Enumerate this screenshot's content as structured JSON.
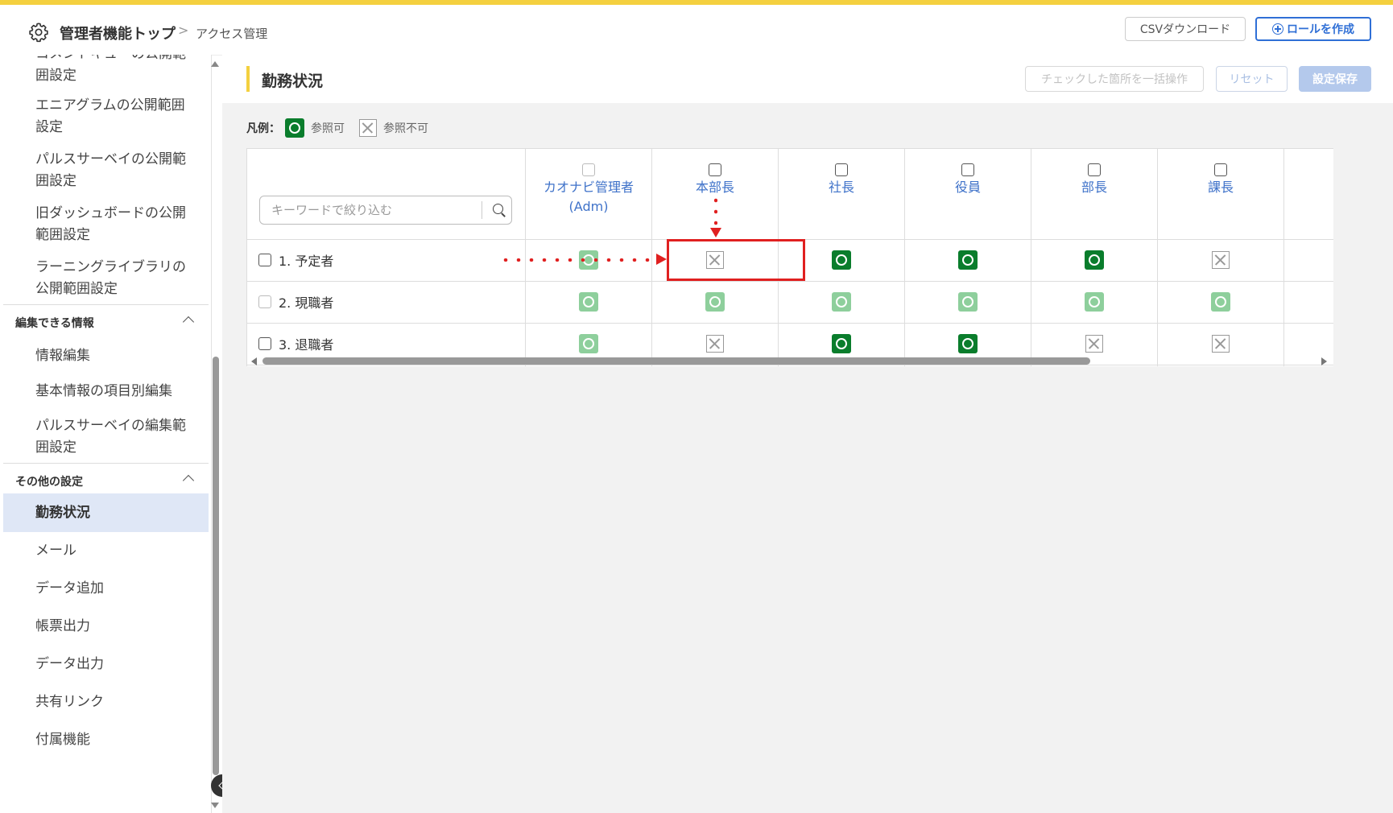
{
  "header": {
    "breadcrumb_root": "管理者機能トップ",
    "breadcrumb_separator": ">",
    "breadcrumb_current": "アクセス管理",
    "csv_button": "CSVダウンロード",
    "create_role_button": "ロールを作成",
    "accent_color": "#f4d03f",
    "primary_color": "#2f6fd6"
  },
  "sidebar": {
    "items_top": [
      "コメントキューの公開範囲設定",
      "エニアグラムの公開範囲設定",
      "パルスサーベイの公開範囲設定",
      "旧ダッシュボードの公開範囲設定",
      "ラーニングライブラリの公開範囲設定"
    ],
    "section_edit": {
      "label": "編集できる情報",
      "items": [
        "情報編集",
        "基本情報の項目別編集",
        "パルスサーベイの編集範囲設定"
      ]
    },
    "section_other": {
      "label": "その他の設定",
      "items": [
        "勤務状況",
        "メール",
        "データ追加",
        "帳票出力",
        "データ出力",
        "共有リンク",
        "付属機能"
      ],
      "active": "勤務状況"
    }
  },
  "main": {
    "title": "勤務状況",
    "bulk_button": "チェックした箇所を一括操作",
    "reset_button": "リセット",
    "save_button": "設定保存",
    "legend_label": "凡例：",
    "legend_ok": "参照可",
    "legend_ng": "参照不可",
    "search_placeholder": "キーワードで絞り込む",
    "columns": [
      "カオナビ管理者",
      "(Adm)",
      "本部長",
      "社長",
      "役員",
      "部長",
      "課長"
    ],
    "rows": [
      {
        "label": "1. 予定者",
        "cells": [
          "ok-light",
          "ng",
          "ok",
          "ok",
          "ok",
          "ng"
        ]
      },
      {
        "label": "2. 現職者",
        "cells": [
          "ok-light",
          "ok-light",
          "ok-light",
          "ok-light",
          "ok-light",
          "ok-light"
        ]
      },
      {
        "label": "3. 退職者",
        "cells": [
          "ok-light",
          "ng",
          "ok",
          "ok",
          "ng",
          "ng"
        ]
      }
    ],
    "ok_color": "#0a7d2c",
    "ok_light_color": "#8ecf9c",
    "annotation_color": "#e02020"
  }
}
